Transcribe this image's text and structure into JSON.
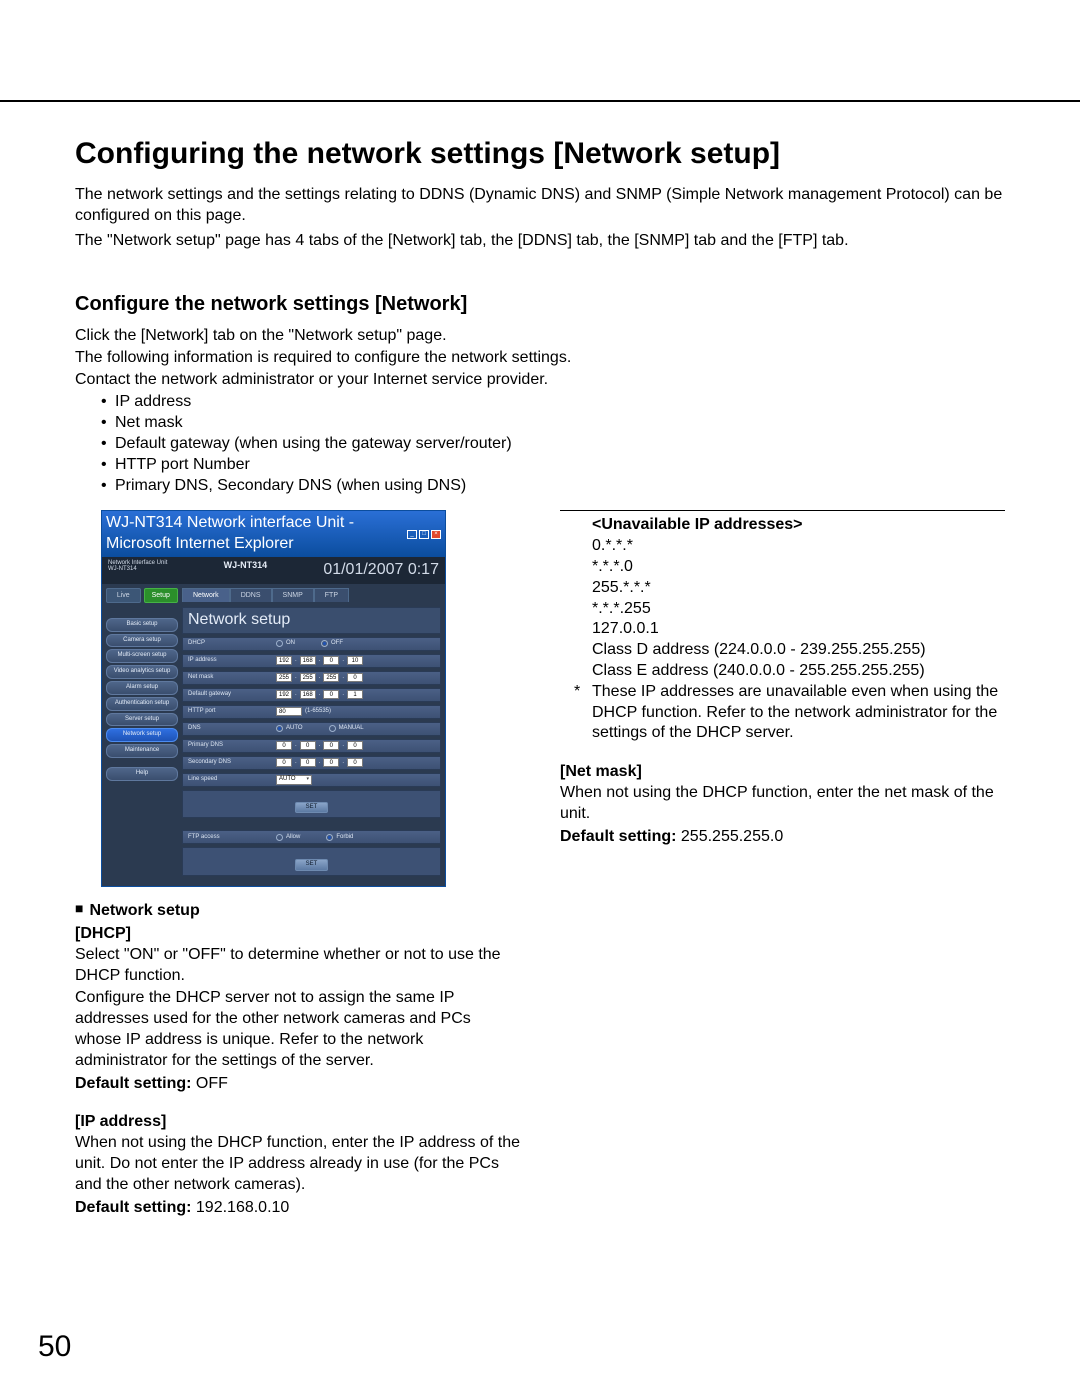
{
  "page_number": "50",
  "title": "Configuring the network settings [Network setup]",
  "intro": {
    "p1": "The network settings and the settings relating to DDNS (Dynamic DNS) and SNMP (Simple Network management Protocol) can be configured on this page.",
    "p2": "The \"Network setup\" page has 4 tabs of the [Network] tab, the [DDNS] tab, the [SNMP] tab and the [FTP] tab."
  },
  "section": {
    "heading": "Configure the network settings [Network]",
    "p1": "Click the [Network] tab on the \"Network setup\" page.",
    "p2": "The following information is required to configure the network settings.",
    "p3": "Contact the network administrator or your Internet service provider.",
    "bullets": [
      "IP address",
      "Net mask",
      "Default gateway (when using the gateway server/router)",
      "HTTP port Number",
      "Primary DNS, Secondary DNS (when using DNS)"
    ]
  },
  "left": {
    "network_setup_title": "Network setup",
    "dhcp": {
      "heading": "[DHCP]",
      "p1": "Select \"ON\" or \"OFF\" to determine whether or not to use the DHCP function.",
      "p2": "Configure the DHCP server not to assign the same IP addresses used for the other network cameras and PCs whose IP address is unique. Refer to the network administrator for the settings of the server.",
      "default_label": "Default setting:",
      "default_value": " OFF"
    },
    "ip": {
      "heading": "[IP address]",
      "p1": "When not using the DHCP function, enter the IP address of the unit. Do not enter the IP address already in use (for the PCs and the other network cameras).",
      "default_label": "Default setting:",
      "default_value": " 192.168.0.10"
    }
  },
  "right": {
    "unavailable_heading": "<Unavailable IP addresses>",
    "items": [
      "0.*.*.*",
      "*.*.*.0",
      "255.*.*.*",
      "*.*.*.255",
      "127.0.0.1",
      "Class D address (224.0.0.0 - 239.255.255.255)",
      "Class E address (240.0.0.0 - 255.255.255.255)"
    ],
    "note": "These IP addresses are unavailable even when using the DHCP function. Refer to the network administrator for the settings of the DHCP server.",
    "netmask": {
      "heading": "[Net mask]",
      "p1": "When not using the DHCP function, enter the net mask of the unit.",
      "default_label": "Default setting:",
      "default_value": " 255.255.255.0"
    }
  },
  "screenshot": {
    "window_title": "WJ-NT314 Network interface Unit - Microsoft Internet Explorer",
    "brand_small": "Network Interface Unit",
    "brand_sub": "WJ-NT314",
    "brand": "WJ-NT314",
    "date": "01/01/2007  0:17",
    "btn_live": "Live",
    "btn_setup": "Setup",
    "sidebar": [
      "Basic setup",
      "Camera setup",
      "Multi-screen setup",
      "Video analytics setup",
      "Alarm setup",
      "Authentication setup",
      "Server setup",
      "Network setup",
      "Maintenance"
    ],
    "help": "Help",
    "tabs": [
      "Network",
      "DDNS",
      "SNMP",
      "FTP"
    ],
    "group": "Network setup",
    "rows": {
      "dhcp": {
        "label": "DHCP",
        "on": "ON",
        "off": "OFF"
      },
      "ip": {
        "label": "IP address",
        "oct": [
          "192",
          "168",
          "0",
          "10"
        ]
      },
      "mask": {
        "label": "Net mask",
        "oct": [
          "255",
          "255",
          "255",
          "0"
        ]
      },
      "gw": {
        "label": "Default gateway",
        "oct": [
          "192",
          "168",
          "0",
          "1"
        ]
      },
      "http": {
        "label": "HTTP port",
        "val": "80",
        "hint": "(1-65535)"
      },
      "dns": {
        "label": "DNS",
        "auto": "AUTO",
        "manual": "MANUAL"
      },
      "pdns": {
        "label": "Primary DNS",
        "oct": [
          "0",
          "0",
          "0",
          "0"
        ]
      },
      "sdns": {
        "label": "Secondary DNS",
        "oct": [
          "0",
          "0",
          "0",
          "0"
        ]
      },
      "line": {
        "label": "Line speed",
        "val": "AUTO"
      }
    },
    "set_label": "SET",
    "ftp_row": {
      "label": "FTP access",
      "allow": "Allow",
      "forbid": "Forbid"
    }
  }
}
